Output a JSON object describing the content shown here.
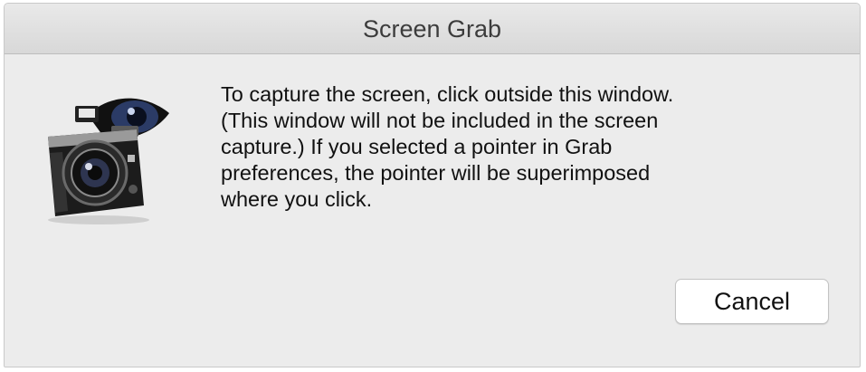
{
  "dialog": {
    "title": "Screen Grab",
    "icon": "grab-camera-icon",
    "message": "To capture the screen, click outside this window.\n(This window will not be included in the screen\ncapture.)  If you selected a pointer in Grab\npreferences, the pointer will be superimposed\nwhere you click.",
    "cancel_label": "Cancel"
  },
  "colors": {
    "window_background": "#ececec",
    "titlebar": "#dedede",
    "button_background": "#ffffff",
    "text": "#111111"
  }
}
